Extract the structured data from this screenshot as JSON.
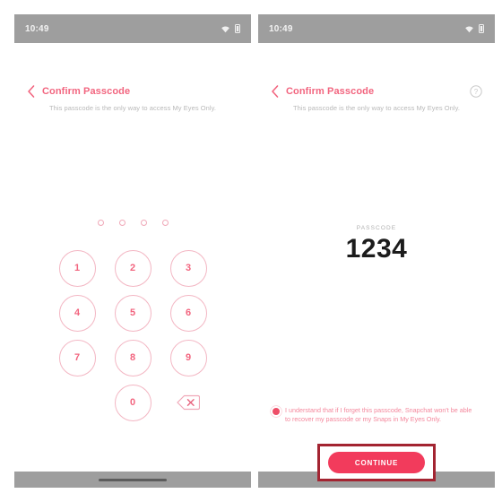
{
  "panels": {
    "left": {
      "statusbar": {
        "time": "10:49",
        "wifi_icon": "wifi-icon",
        "battery_icon": "battery-icon"
      },
      "header": {
        "back_icon": "back-chevron-icon",
        "title": "Confirm Passcode"
      },
      "subtitle": "This passcode is the only way to access My Eyes Only.",
      "pin_dots": {
        "count": 4,
        "filled": 0
      },
      "keypad": {
        "keys": [
          "1",
          "2",
          "3",
          "4",
          "5",
          "6",
          "7",
          "8",
          "9",
          "",
          "0",
          ""
        ],
        "backspace_icon": "backspace-icon"
      },
      "navbar": {
        "handle": "gesture-handle"
      }
    },
    "right": {
      "statusbar": {
        "time": "10:49",
        "wifi_icon": "wifi-icon",
        "battery_icon": "battery-icon"
      },
      "header": {
        "back_icon": "back-chevron-icon",
        "title": "Confirm Passcode",
        "help_icon": "help-circle-icon"
      },
      "subtitle": "This passcode is the only way to access My Eyes Only.",
      "passcode": {
        "label": "PASSCODE",
        "value": "1234"
      },
      "consent": {
        "radio_icon": "radio-selected-icon",
        "text": "I understand that if I forget this passcode, Snapchat won't be able to recover my passcode or my Snaps in My Eyes Only."
      },
      "continue": {
        "label": "CONTINUE"
      },
      "navbar": {
        "handle": "gesture-handle"
      }
    }
  },
  "colors": {
    "accent_pink": "#f2657f",
    "button_pink": "#f23b5c",
    "annotation_red": "#a32431",
    "statusbar_gray": "#9e9e9e",
    "subtitle_gray": "#b9b9b9",
    "passcode_dark": "#1c1c1c"
  }
}
